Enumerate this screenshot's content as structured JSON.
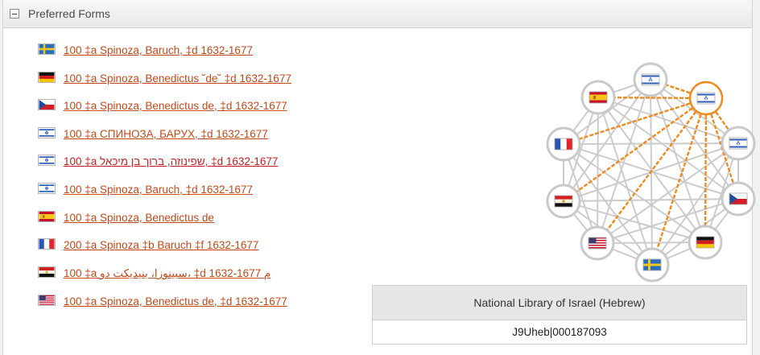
{
  "section": {
    "title": "Preferred Forms"
  },
  "forms": [
    {
      "flag": "sweden-flag",
      "text": "100 ‡a  Spinoza, Baruch, ‡d  1632-1677"
    },
    {
      "flag": "germany-flag",
      "text": "100 ‡a  Spinoza, Benedictus ˘de˘ ‡d  1632-1677"
    },
    {
      "flag": "czech-flag",
      "text": "100 ‡a  Spinoza, Benedictus de, ‡d  1632-1677"
    },
    {
      "flag": "israel-flag",
      "text": "100 ‡a  СПИНОЗА, БАРУХ, ‡d  1632-1677"
    },
    {
      "flag": "israel-flag",
      "text": "100 ‡a  שפינוזה, ברוך בן מיכאל, ‡d  1632-1677"
    },
    {
      "flag": "israel-flag",
      "text": "100 ‡a  Spinoza, Baruch, ‡d  1632-1677"
    },
    {
      "flag": "spain-flag",
      "text": "100 ‡a  Spinoza, Benedictus de"
    },
    {
      "flag": "france-flag",
      "text": "200 ‡a  Spinoza ‡b  Baruch ‡f  1632-1677"
    },
    {
      "flag": "egypt-flag",
      "text": "100 ‡a  سبينوزا، بنيديكت دو، ‡d  1632-1677 م"
    },
    {
      "flag": "usa-flag",
      "text": "100 ‡a  Spinoza, Benedictus de, ‡d  1632-1677"
    }
  ],
  "graph": {
    "nodes": [
      "israel",
      "israel-selected",
      "israel",
      "czech",
      "germany",
      "sweden",
      "usa",
      "egypt",
      "france",
      "spain"
    ],
    "selected": "israel-selected",
    "highlight_color": "#f08a1c",
    "edge_color": "#cccccc"
  },
  "info": {
    "library": "National Library of Israel (Hebrew)",
    "id": "J9Uheb|000187093"
  }
}
